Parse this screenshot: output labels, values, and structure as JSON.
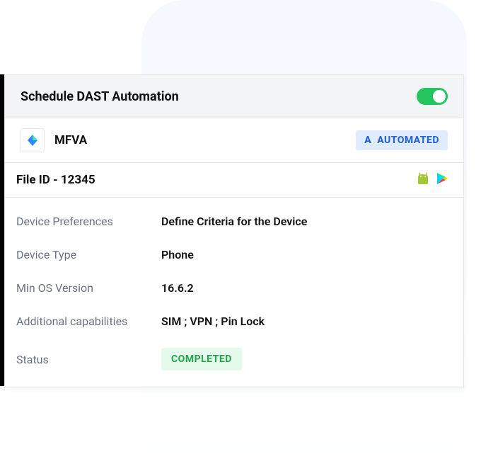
{
  "header": {
    "title": "Schedule DAST Automation",
    "toggle_on": true
  },
  "app": {
    "name": "MFVA",
    "badge_prefix": "A",
    "badge_label": "AUTOMATED"
  },
  "file": {
    "label": "File ID - ",
    "id": "12345"
  },
  "details": {
    "device_preferences": {
      "label": "Device Preferences",
      "value": "Define Criteria for the Device"
    },
    "device_type": {
      "label": "Device Type",
      "value": "Phone"
    },
    "min_os": {
      "label": "Min OS Version",
      "value": "16.6.2"
    },
    "capabilities": {
      "label": "Additional capabilities",
      "value": "SIM ; VPN ; Pin Lock"
    },
    "status": {
      "label": "Status",
      "value": "COMPLETED"
    }
  }
}
